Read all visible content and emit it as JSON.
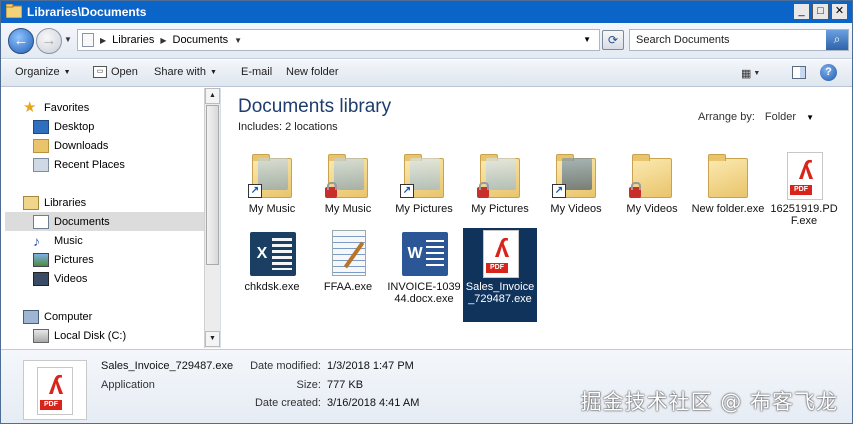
{
  "window": {
    "title": "Libraries\\Documents",
    "buttons": {
      "minimize": "_",
      "maximize": "□",
      "close": "✕"
    }
  },
  "address": {
    "crumbs": [
      "Libraries",
      "Documents"
    ],
    "search_placeholder": "Search Documents"
  },
  "toolbar": {
    "organize": "Organize",
    "open": "Open",
    "share_with": "Share with",
    "email": "E-mail",
    "new_folder": "New folder"
  },
  "nav": {
    "favorites": "Favorites",
    "desktop": "Desktop",
    "downloads": "Downloads",
    "recent_places": "Recent Places",
    "libraries": "Libraries",
    "documents": "Documents",
    "music": "Music",
    "pictures": "Pictures",
    "videos": "Videos",
    "computer": "Computer",
    "local_disk": "Local Disk (C:)"
  },
  "main": {
    "title": "Documents library",
    "includes_label": "Includes:",
    "includes_value": "2 locations",
    "arrange_label": "Arrange by:",
    "arrange_value": "Folder",
    "items": [
      {
        "label": "My Music",
        "icon": "folder-music-shortcut-icon"
      },
      {
        "label": "My Music",
        "icon": "folder-music-locked-icon"
      },
      {
        "label": "My Pictures",
        "icon": "folder-pictures-shortcut-icon"
      },
      {
        "label": "My Pictures",
        "icon": "folder-pictures-locked-icon"
      },
      {
        "label": "My Videos",
        "icon": "folder-videos-shortcut-icon"
      },
      {
        "label": "My Videos",
        "icon": "folder-videos-locked-icon"
      },
      {
        "label": "New folder.exe",
        "icon": "folder-icon"
      },
      {
        "label": "16251919.PDF.exe",
        "icon": "pdf-icon"
      },
      {
        "label": "chkdsk.exe",
        "icon": "excel-icon"
      },
      {
        "label": "FFAA.exe",
        "icon": "notepad-icon"
      },
      {
        "label": "INVOICE-103944.docx.exe",
        "icon": "word-icon"
      },
      {
        "label": "Sales_Invoice_729487.exe",
        "icon": "pdf-icon"
      }
    ]
  },
  "details": {
    "name": "Sales_Invoice_729487.exe",
    "type": "Application",
    "modified_label": "Date modified:",
    "modified_value": "1/3/2018 1:47 PM",
    "size_label": "Size:",
    "size_value": "777 KB",
    "created_label": "Date created:",
    "created_value": "3/16/2018 4:41 AM"
  },
  "watermark": "掘金技术社区 @ 布客飞龙"
}
